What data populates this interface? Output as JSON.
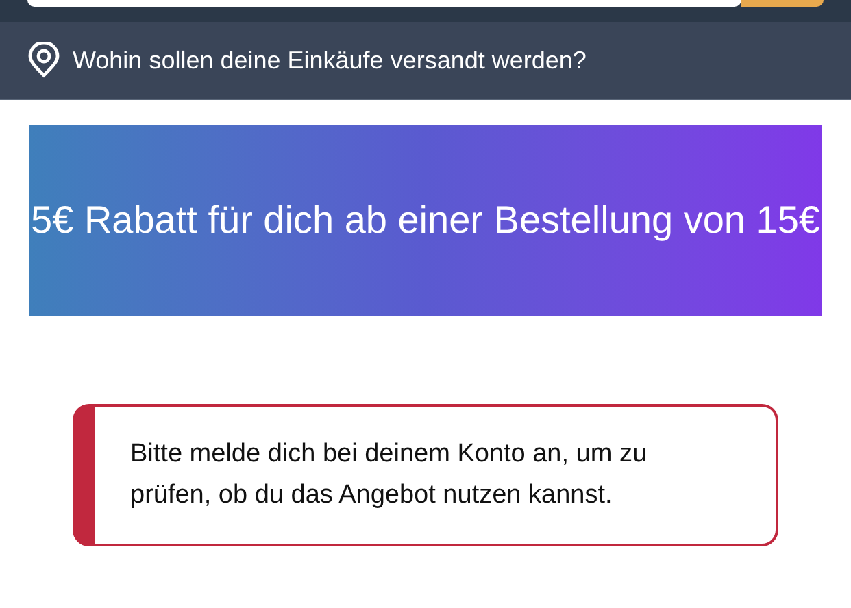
{
  "delivery_bar": {
    "text": "Wohin sollen deine Einkäufe versandt werden?"
  },
  "promo_banner": {
    "text": "5€ Rabatt für dich ab einer Bestellung von 15€"
  },
  "alert": {
    "kind": "error",
    "text": "Bitte melde dich bei deinem Konto an, um zu prüfen, ob du das Angebot nutzen kannst."
  }
}
